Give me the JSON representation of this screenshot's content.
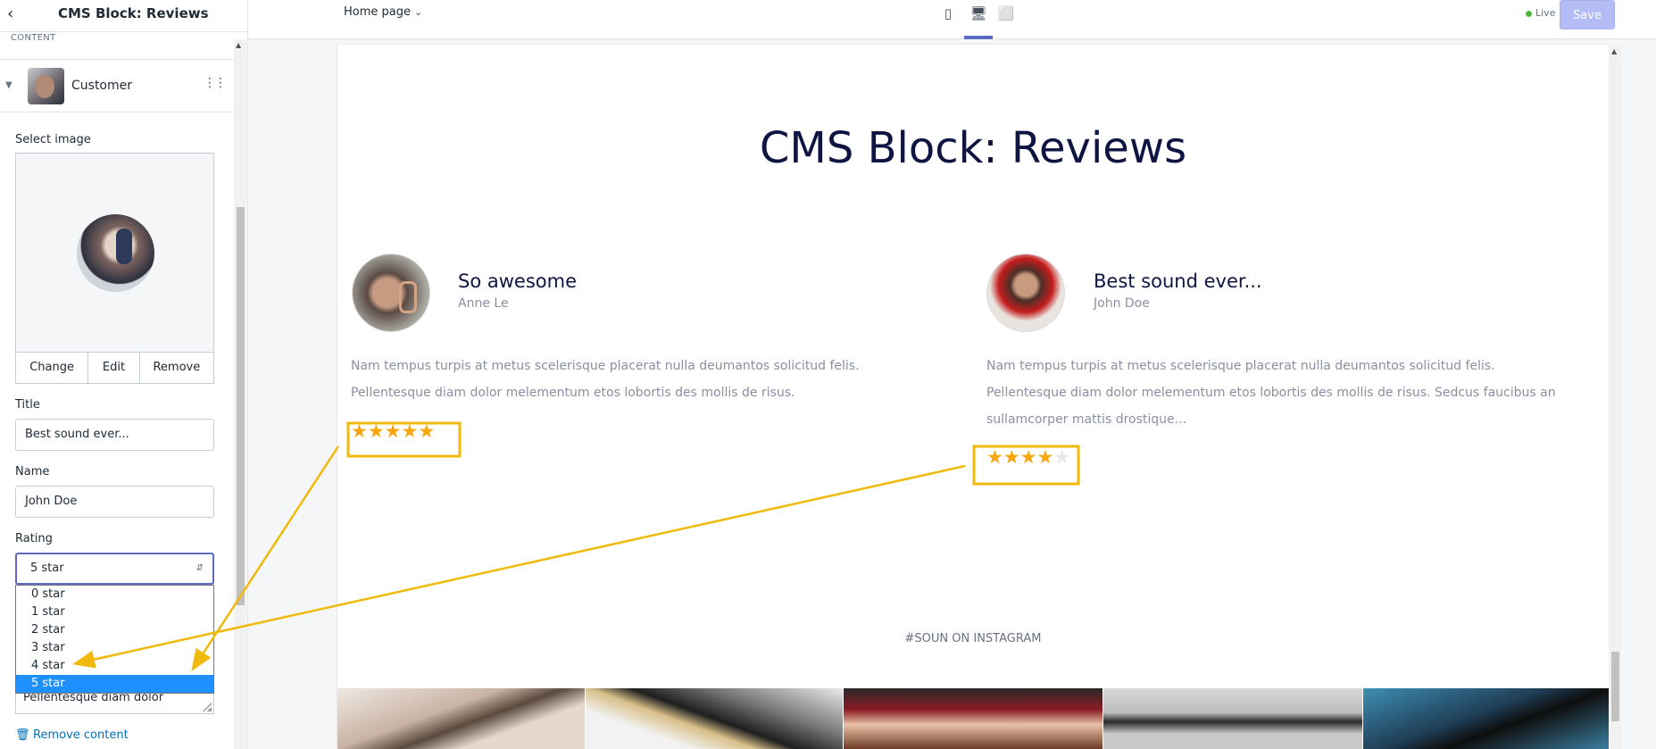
{
  "panel": {
    "title": "CMS Block: Reviews",
    "section_label": "CONTENT",
    "block_label": "Customer",
    "select_image_label": "Select image",
    "image_actions": [
      "Change",
      "Edit",
      "Remove"
    ],
    "title_label": "Title",
    "title_value": "Best sound ever...",
    "name_label": "Name",
    "name_value": "John Doe",
    "rating_label": "Rating",
    "rating_value": "5 star",
    "rating_options": [
      "0 star",
      "1 star",
      "2 star",
      "3 star",
      "4 star",
      "5 star"
    ],
    "rating_selected_index": 5,
    "textarea_peek": "Pellentesque diam dolor",
    "remove_content": "Remove content"
  },
  "topbar": {
    "page_select": "Home page",
    "devices": [
      "mobile-icon",
      "desktop-icon",
      "fullwidth-icon"
    ],
    "active_device": "desktop-icon",
    "status": "Live",
    "status_color": "#50b83c",
    "save_label": "Save"
  },
  "preview": {
    "title": "CMS Block: Reviews",
    "reviews": [
      {
        "title": "So awesome",
        "name": "Anne Le",
        "text": "Nam tempus turpis at metus scelerisque placerat nulla deumantos solicitud felis. Pellentesque diam dolor melementum etos lobortis des mollis de risus.",
        "rating": 5
      },
      {
        "title": "Best sound ever...",
        "name": "John Doe",
        "text": "Nam tempus turpis at metus scelerisque placerat nulla deumantos solicitud felis. Pellentesque diam dolor melementum etos lobortis des mollis de risus. Sedcus faucibus an sullamcorper mattis drostique...",
        "rating": 4
      }
    ],
    "star_color": "#f6a609",
    "instagram_label": "#SOUN ON INSTAGRAM",
    "instagram_photo_count": 5
  },
  "annotation_color": "#f0b90b"
}
